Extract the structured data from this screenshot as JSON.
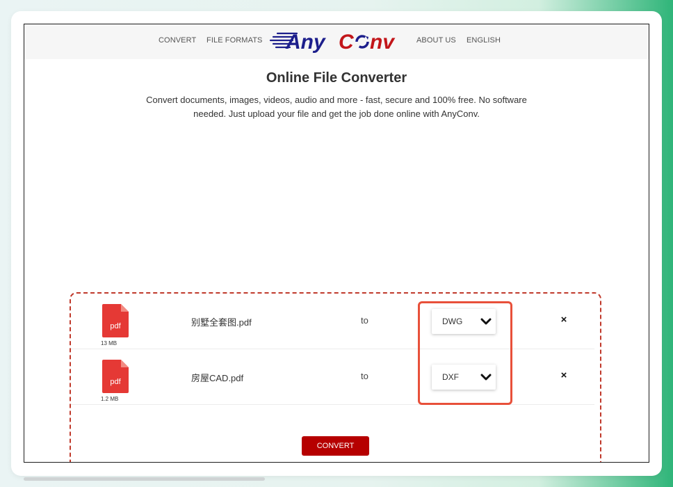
{
  "nav": {
    "convert": "CONVERT",
    "file_formats": "FILE FORMATS",
    "about_us": "ABOUT US",
    "language": "ENGLISH"
  },
  "logo": {
    "text_any": "Any",
    "text_conv": "C",
    "text_conv_end": "nv",
    "colors": {
      "any": "#1d1f8c",
      "conv": "#c2161a",
      "speed_lines": "#1d1f8c"
    }
  },
  "main": {
    "title": "Online File Converter",
    "description": "Convert documents, images, videos, audio and more - fast, secure and 100% free. No software needed. Just upload your file and get the job done online with AnyConv."
  },
  "files": [
    {
      "icon": "pdf-file-icon",
      "icon_label": "pdf",
      "size": "13 MB",
      "name": "别墅全套图.pdf",
      "to": "to",
      "format": "DWG",
      "remove": "×"
    },
    {
      "icon": "pdf-file-icon",
      "icon_label": "pdf",
      "size": "1.2 MB",
      "name": "房屋CAD.pdf",
      "to": "to",
      "format": "DXF",
      "remove": "×"
    }
  ],
  "convert_button": "CONVERT",
  "colors": {
    "accent_red": "#b60000",
    "dropzone_border": "#c0392b",
    "highlight_box": "#e8503a",
    "pdf_icon": "#e53935"
  }
}
